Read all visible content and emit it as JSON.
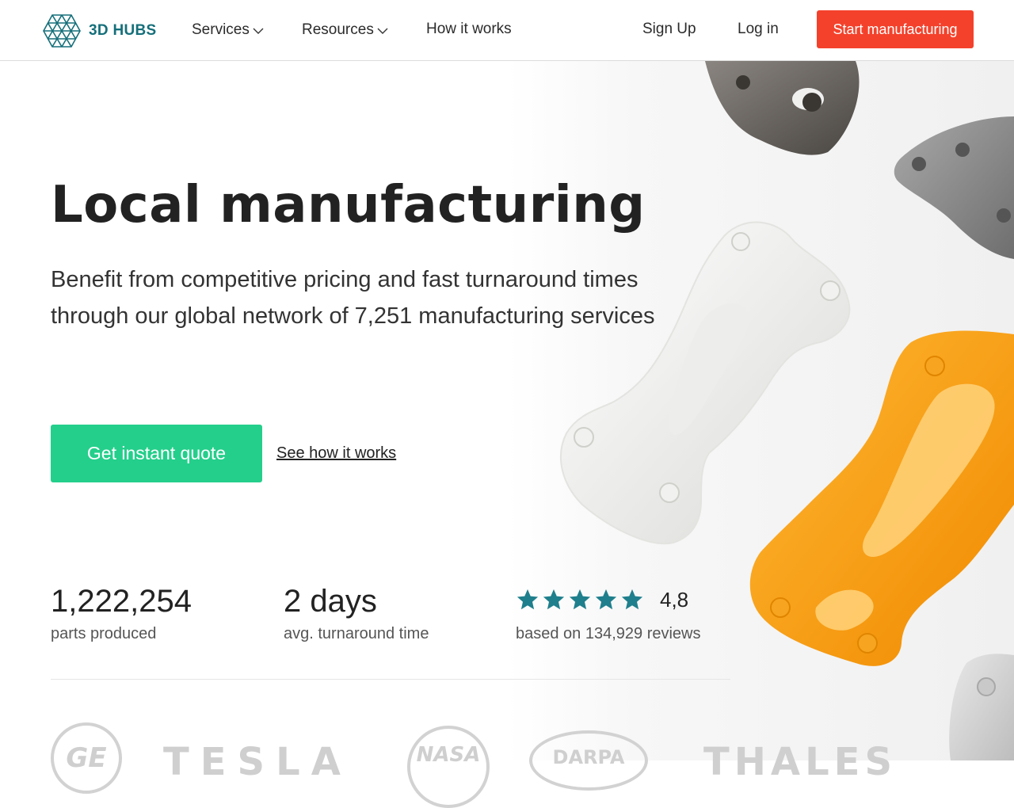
{
  "nav": {
    "brand": "3D HUBS",
    "services": "Services",
    "resources": "Resources",
    "how_it_works": "How it works",
    "sign_up": "Sign Up",
    "log_in": "Log in",
    "start_manufacturing": "Start manufacturing"
  },
  "hero": {
    "title": "Local manufacturing",
    "subtitle": "Benefit from competitive pricing and fast turnaround times through our global network of 7,251 manufacturing services",
    "primary_cta": "Get instant quote",
    "secondary_cta": "See how it works"
  },
  "stats": {
    "parts_value": "1,222,254",
    "parts_label": "parts produced",
    "turnaround_value": "2 days",
    "turnaround_label": "avg. turnaround time",
    "rating_value": "4,8",
    "rating_stars": 5,
    "reviews_label": "based on 134,929 reviews"
  },
  "clients": {
    "ge": "GE",
    "tesla": "TESLA",
    "nasa": "NASA",
    "darpa": "DARPA",
    "thales": "THALES"
  },
  "colors": {
    "brand_teal": "#156f7a",
    "start_red": "#f4412b",
    "quote_green": "#24cf8b",
    "star_teal": "#1f7f8c"
  },
  "icons": {
    "logo": "hexagon-grid-logo-icon",
    "dropdown": "chevron-down-icon",
    "star": "star-icon"
  }
}
